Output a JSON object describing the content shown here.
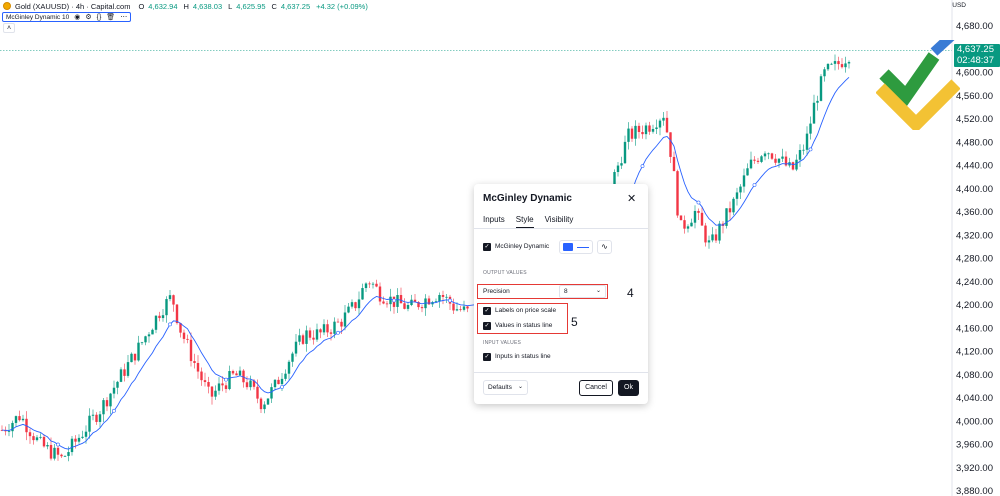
{
  "header": {
    "symbol": "Gold (XAUUSD) · 4h · Capital.com",
    "ohlc": [
      {
        "k": "O",
        "v": "4,632.94"
      },
      {
        "k": "H",
        "v": "4,638.03"
      },
      {
        "k": "L",
        "v": "4,625.95"
      },
      {
        "k": "C",
        "v": "4,637.25"
      }
    ],
    "change": "+4.32 (+0.09%)",
    "currency": "USD"
  },
  "indicator_legend": {
    "name": "McGinley Dynamic 10",
    "icons": [
      "eye-icon",
      "gear-icon",
      "source-code-icon",
      "trash-icon",
      "more-icon"
    ]
  },
  "price_axis": {
    "labels": [
      "4,680.00",
      "4,600.00",
      "4,560.00",
      "4,520.00",
      "4,480.00",
      "4,440.00",
      "4,400.00",
      "4,360.00",
      "4,320.00",
      "4,280.00",
      "4,240.00",
      "4,200.00",
      "4,160.00",
      "4,120.00",
      "4,080.00",
      "4,040.00",
      "4,000.00",
      "3,960.00",
      "3,920.00",
      "3,880.00"
    ],
    "current_price": "4,637.25",
    "countdown": "02:48:37"
  },
  "colors": {
    "bull": "#089981",
    "bear": "#f23645",
    "indicator": "#2962ff",
    "highlight": "#e53935",
    "logo_green": "#2e9b3f",
    "logo_yellow": "#f3c234",
    "logo_blue": "#3a7bd5"
  },
  "dialog": {
    "title": "McGinley Dynamic",
    "tabs": [
      "Inputs",
      "Style",
      "Visibility"
    ],
    "active_tab": "Style",
    "plot_label": "McGinley Dynamic",
    "output_values_header": "OUTPUT VALUES",
    "precision_label": "Precision",
    "precision_value": "8",
    "labels_on_price_scale": "Labels on price scale",
    "values_in_status_line": "Values in status line",
    "input_values_header": "INPUT VALUES",
    "inputs_in_status_line": "Inputs in status line",
    "defaults_label": "Defaults",
    "cancel_label": "Cancel",
    "ok_label": "Ok"
  },
  "annotations": {
    "marker_4": "4",
    "marker_5": "5"
  }
}
